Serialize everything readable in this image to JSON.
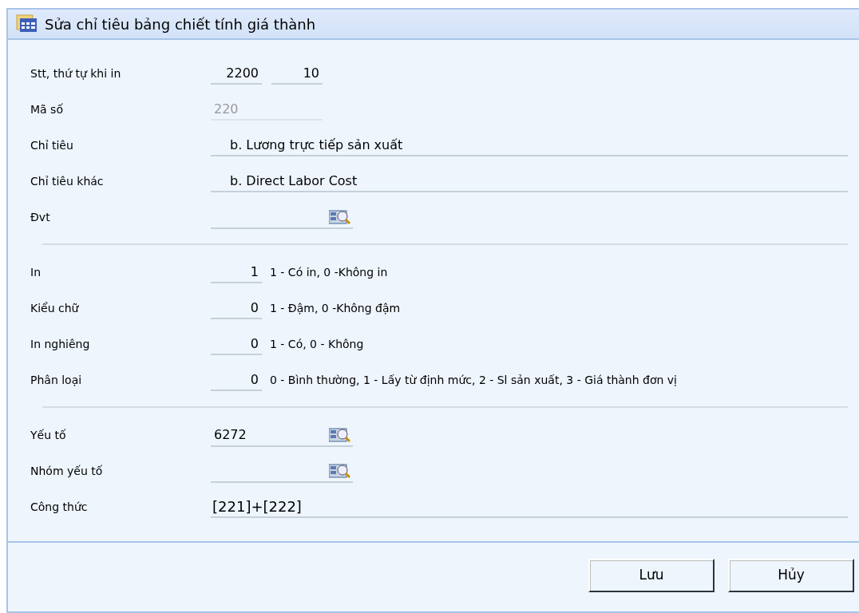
{
  "window": {
    "title": "Sửa chỉ tiêu bảng chiết tính giá thành"
  },
  "sections": [
    {
      "rows": [
        {
          "label": "Stt, thứ tự khi in",
          "kind": "pair",
          "values": [
            "2200",
            "10"
          ],
          "disabled": false
        },
        {
          "label": "Mã số",
          "kind": "code",
          "value": "220",
          "disabled": true
        },
        {
          "label": "Chỉ tiêu",
          "kind": "text",
          "value": "b. Lương trực tiếp sản xuất",
          "disabled": false
        },
        {
          "label": "Chỉ tiêu khác",
          "kind": "text",
          "value": "b. Direct Labor Cost",
          "disabled": false
        },
        {
          "label": "Đvt",
          "kind": "lookup",
          "value": "",
          "disabled": false
        }
      ]
    },
    {
      "rows": [
        {
          "label": "In",
          "kind": "flag",
          "value": "1",
          "note": "1 - Có in, 0 -Không in",
          "disabled": false
        },
        {
          "label": "Kiểu chữ",
          "kind": "flag",
          "value": "0",
          "note": "1 - Đậm, 0 -Không đậm",
          "disabled": false
        },
        {
          "label": "In nghiêng",
          "kind": "flag",
          "value": "0",
          "note": "1 - Có, 0 - Không",
          "disabled": false
        },
        {
          "label": "Phân loại",
          "kind": "flag",
          "value": "0",
          "note": "0 - Bình thường, 1 - Lấy từ định mức, 2 - Sl sản xuất, 3 - Giá thành đơn vị",
          "disabled": false
        }
      ]
    },
    {
      "rows": [
        {
          "label": "Yếu tố",
          "kind": "lookup",
          "value": "6272",
          "disabled": false
        },
        {
          "label": "Nhóm yếu tố",
          "kind": "lookup",
          "value": "",
          "disabled": false
        },
        {
          "label": "Công thức",
          "kind": "formula",
          "value": "[221]+[222]",
          "disabled": false
        }
      ]
    }
  ],
  "buttons": [
    "Lưu",
    "Hủy"
  ]
}
